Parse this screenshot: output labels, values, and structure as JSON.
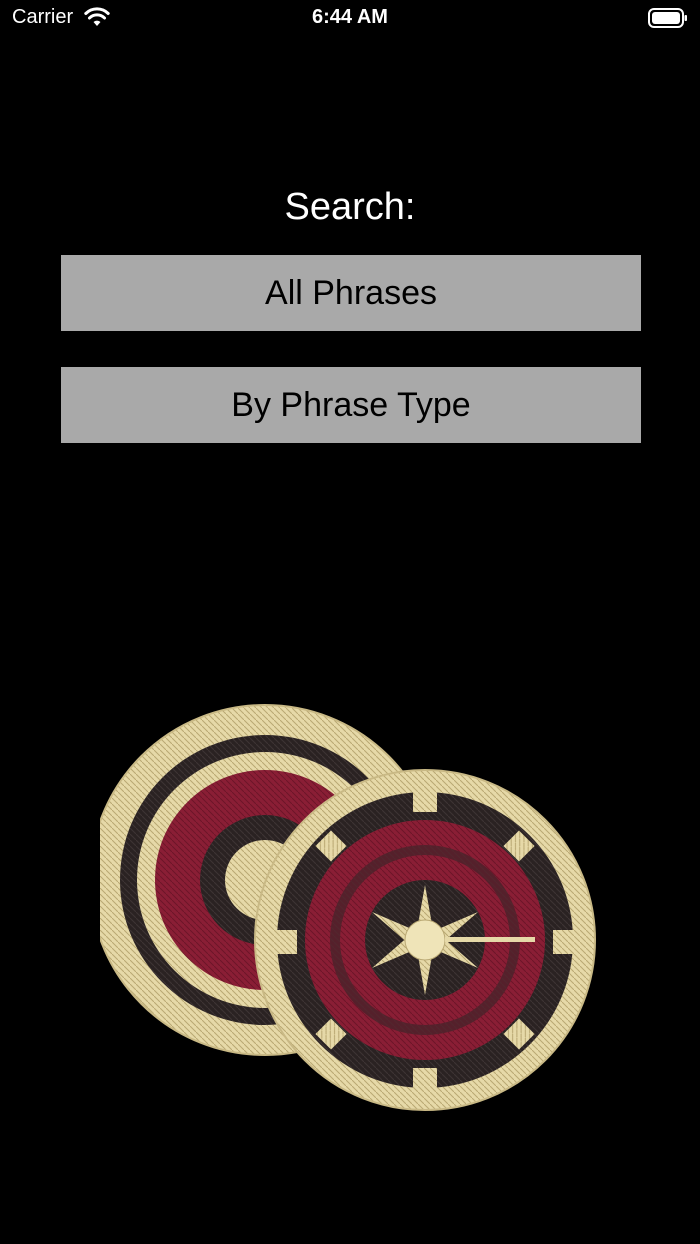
{
  "status_bar": {
    "carrier": "Carrier",
    "time": "6:44 AM"
  },
  "main": {
    "search_label": "Search:",
    "buttons": [
      {
        "label": "All Phrases"
      },
      {
        "label": "By Phrase Type"
      }
    ]
  },
  "colors": {
    "background": "#000000",
    "button_bg": "#a9a9a9",
    "basket_straw": "#e8dcae",
    "basket_dark": "#2b2222",
    "basket_red": "#8a1e35"
  },
  "icons": {
    "wifi": "wifi-icon",
    "battery": "battery-icon"
  }
}
